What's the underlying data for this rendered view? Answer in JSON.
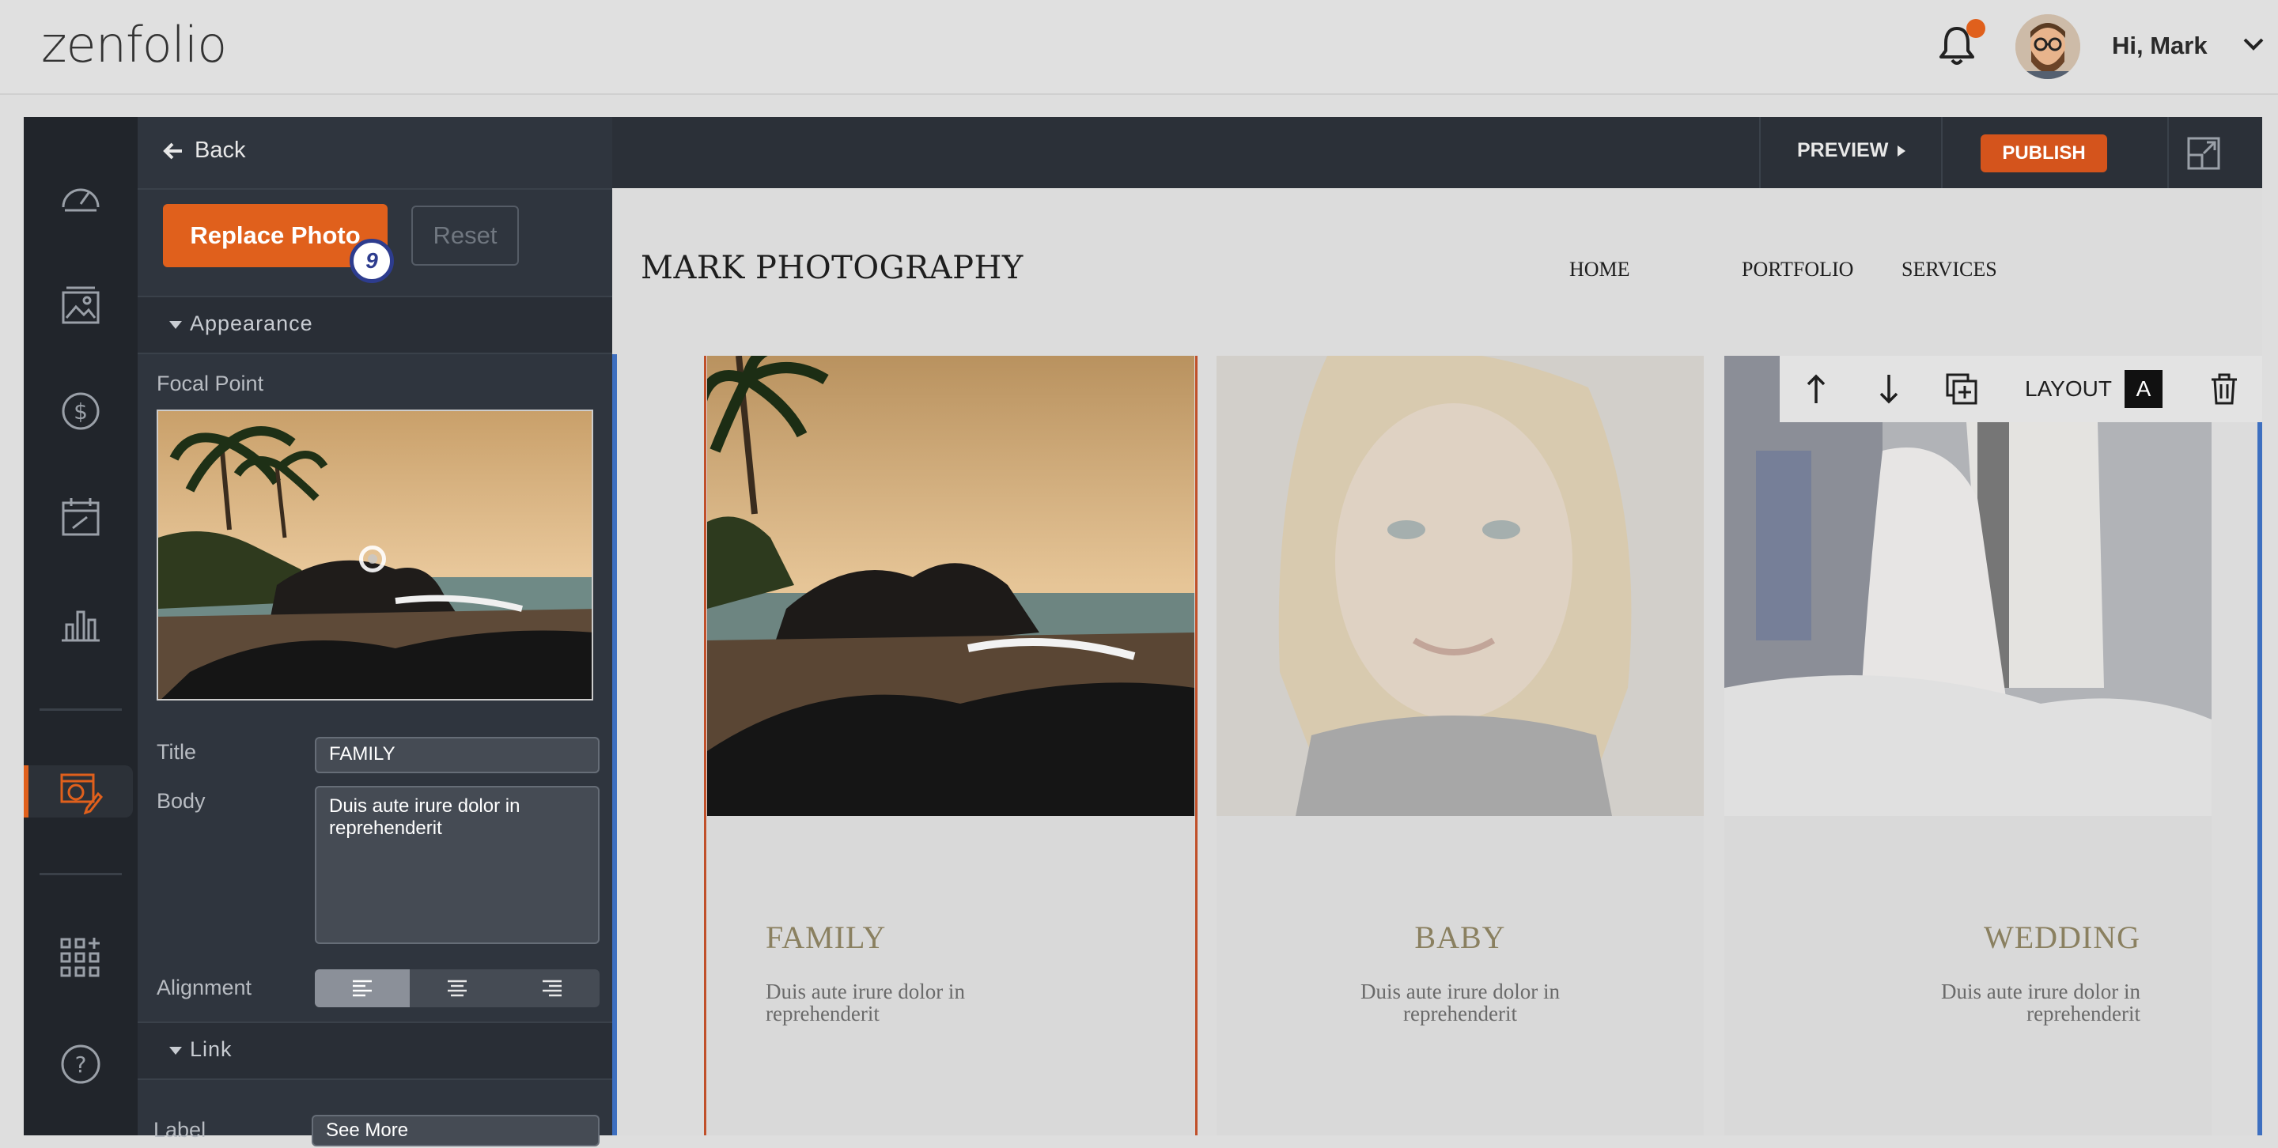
{
  "header": {
    "logo": "zenfolio",
    "greeting": "Hi, Mark"
  },
  "panel": {
    "back_label": "Back",
    "replace_photo_label": "Replace Photo",
    "step_badge": "9",
    "reset_label": "Reset",
    "appearance_label": "Appearance",
    "focal_point_label": "Focal Point",
    "title_label": "Title",
    "title_value": "FAMILY",
    "body_label": "Body",
    "body_value": "Duis aute irure dolor in reprehenderit",
    "alignment_label": "Alignment",
    "link_label": "Link",
    "label_label": "Label",
    "label_value": "See More"
  },
  "editor_toolbar": {
    "preview_label": "PREVIEW",
    "publish_label": "PUBLISH"
  },
  "site": {
    "title": "MARK PHOTOGRAPHY",
    "nav": [
      "HOME",
      "PORTFOLIO",
      "SERVICES"
    ],
    "cards": [
      {
        "title": "FAMILY",
        "body": "Duis aute irure dolor in reprehenderit"
      },
      {
        "title": "BABY",
        "body": "Duis aute irure dolor in reprehenderit"
      },
      {
        "title": "WEDDING",
        "body": "Duis aute irure dolor in reprehenderit"
      }
    ],
    "layout_label": "LAYOUT",
    "layout_value": "A"
  },
  "colors": {
    "accent": "#e0601c",
    "rail_bg": "#21252b",
    "panel_bg": "#2f353e",
    "selection_blue": "#3d6fc0"
  }
}
